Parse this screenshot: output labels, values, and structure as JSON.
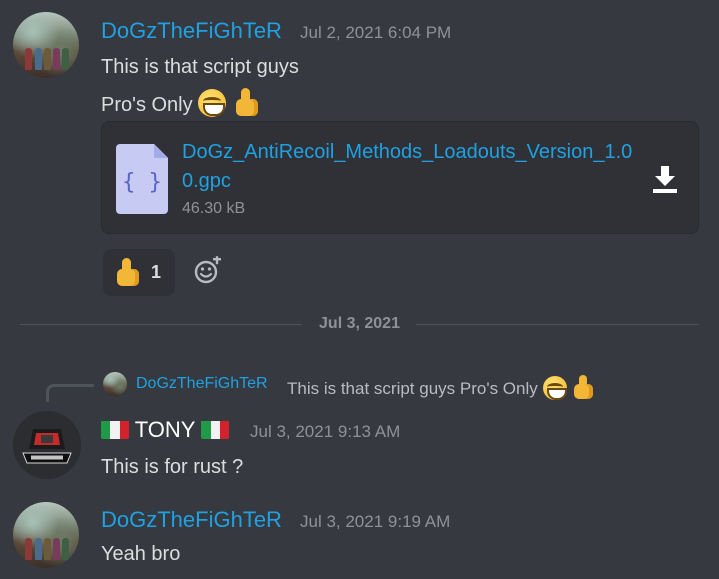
{
  "messages": [
    {
      "author": "DoGzTheFiGhTeR",
      "timestamp": "Jul 2, 2021 6:04 PM",
      "lines": [
        "This is that script guys",
        "Pro's Only"
      ],
      "attachment": {
        "filename": "DoGz_AntiRecoil_Methods_Loadouts_Version_1.00.gpc",
        "size": "46.30 kB"
      },
      "reactions": [
        {
          "emoji": "thumbs-up",
          "count": "1"
        }
      ]
    },
    {
      "author": "TONY",
      "timestamp": "Jul 3, 2021 9:13 AM",
      "reply_to": {
        "author": "DoGzTheFiGhTeR",
        "text": "This is that script guys Pro's Only"
      },
      "text": "This is for rust ?"
    },
    {
      "author": "DoGzTheFiGhTeR",
      "timestamp": "Jul 3, 2021 9:19 AM",
      "text": "Yeah bro"
    }
  ],
  "divider": {
    "date": "Jul 3, 2021"
  },
  "colors": {
    "background": "#36393f",
    "username_link": "#1fa1e2",
    "text": "#dcddde",
    "muted": "#8e9297",
    "card": "#2f3136"
  },
  "icons": {
    "download": "download-icon",
    "add_reaction": "add-reaction-icon",
    "file": "code-file-icon",
    "flag": "italy-flag-icon"
  }
}
